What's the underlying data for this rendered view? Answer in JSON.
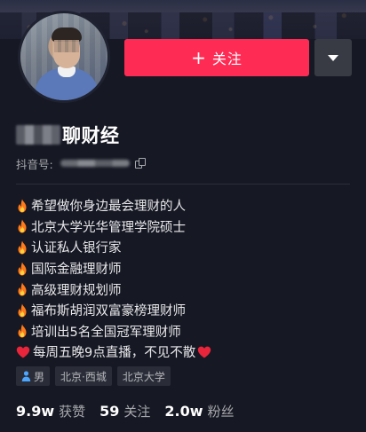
{
  "profile": {
    "name_suffix": "聊财经",
    "id_label": "抖音号:"
  },
  "actions": {
    "follow_icon": "+",
    "follow_label": "关注",
    "dropdown_icon": "triangle-down-icon"
  },
  "bio": {
    "lines": [
      "希望做你身边最会理财的人",
      "北京大学光华管理学院硕士",
      "认证私人银行家",
      "国际金融理财师",
      "高级理财规划师",
      "福布斯胡润双富豪榜理财师",
      "培训出5名全国冠军理财师"
    ],
    "last_line": "每周五晚9点直播，不见不散",
    "line_icon": "fire-icon",
    "last_line_icon": "heart-icon"
  },
  "tags": {
    "gender": "男",
    "location": "北京·西城",
    "school": "北京大学"
  },
  "stats": {
    "likes_value": "9.9w",
    "likes_label": "获赞",
    "following_value": "59",
    "following_label": "关注",
    "followers_value": "2.0w",
    "followers_label": "粉丝"
  },
  "colors": {
    "background": "#161823",
    "follow_button": "#fe2c55",
    "fire": "#ff7a1a",
    "heart": "#e8253a"
  }
}
